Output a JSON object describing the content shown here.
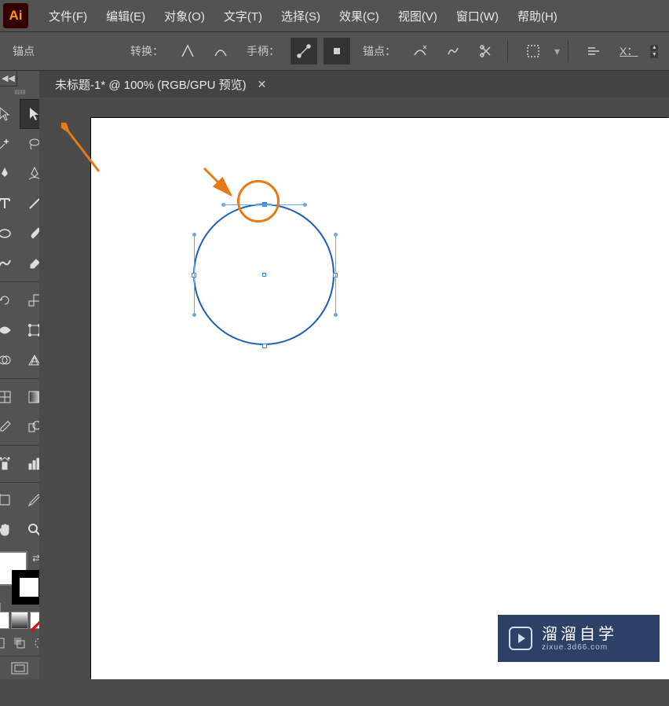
{
  "menu": {
    "file": "文件(F)",
    "edit": "编辑(E)",
    "object": "对象(O)",
    "type": "文字(T)",
    "select": "选择(S)",
    "effect": "效果(C)",
    "view": "视图(V)",
    "window": "窗口(W)",
    "help": "帮助(H)"
  },
  "controlbar": {
    "anchor_label": "锚点",
    "convert_label": "转换：",
    "handles_label": "手柄：",
    "anchors_label": "锚点：",
    "x_label": "X："
  },
  "tab": {
    "title": "未标题-1* @ 100% (RGB/GPU 预览)"
  },
  "watermark": {
    "title": "溜溜自学",
    "url": "zixue.3d66.com"
  },
  "logo_text": "Ai"
}
